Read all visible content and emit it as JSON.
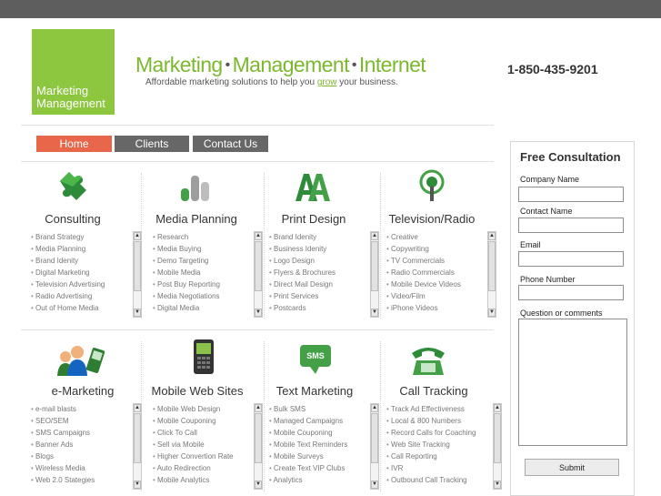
{
  "logo": {
    "line1": "Marketing",
    "line2": "Management"
  },
  "brand": {
    "word1": "Marketing",
    "word2": "Management",
    "word3": "Internet",
    "separator": "•"
  },
  "tagline": {
    "before": "Affordable marketing solutions to help you ",
    "link": "grow",
    "after": " your business."
  },
  "phone": "1-850-435-9201",
  "nav": {
    "home": "Home",
    "clients": "Clients",
    "contact": "Contact Us"
  },
  "services": [
    {
      "title": "Consulting",
      "items": [
        "Brand Strategy",
        "Media Planning",
        "Brand Idenity",
        "Digital Marketing",
        "Television Advertising",
        "Radio Advertising",
        "Out of Home Media"
      ]
    },
    {
      "title": "Media Planning",
      "items": [
        "Research",
        "Media Buying",
        "Demo Targeting",
        "Mobile Media",
        "Post Buy Reporting",
        "Media Negotiations",
        "Digital Media"
      ]
    },
    {
      "title": "Print Design",
      "items": [
        "Brand Idenity",
        "Business Idenity",
        "Logo Design",
        "Flyers & Brochures",
        "Direct Mail Design",
        "Print Services",
        "Postcards"
      ]
    },
    {
      "title": "Television/Radio",
      "items": [
        "Creative",
        "Copywriting",
        "TV Commercials",
        "Radio Commercials",
        "Mobile Device Videos",
        "Video/Film",
        "iPhone Videos"
      ]
    },
    {
      "title": "e-Marketing",
      "items": [
        "e-mail blasts",
        "SEO/SEM",
        "SMS Campaigns",
        "Banner Ads",
        "Blogs",
        "Wireless Media",
        "Web 2.0 Stategies"
      ]
    },
    {
      "title": "Mobile Web Sites",
      "items": [
        "Mobile Web Design",
        "Mobile Couponing",
        "Click To Call",
        "Sell via Mobile",
        "Higher Convertion Rate",
        "Auto Redirection",
        "Mobile Analytics"
      ]
    },
    {
      "title": "Text Marketing",
      "items": [
        "Bulk SMS",
        "Managed Campaigns",
        "Mobile Couponing",
        "Mobile Text Reminders",
        "Mobile Surveys",
        "Create Text VIP Clubs",
        "Analytics"
      ]
    },
    {
      "title": "Call Tracking",
      "items": [
        "Track Ad Effectiveness",
        "Local & 800 Numbers",
        "Record Calls for Coaching",
        "Web Site Tracking",
        "Call Reporting",
        "IVR",
        "Outbound Call Tracking"
      ]
    }
  ],
  "icons": {
    "sms_text": "SMS"
  },
  "consultation": {
    "title": "Free Consultation",
    "company_label": "Company Name",
    "contact_label": "Contact Name",
    "email_label": "Email",
    "phone_label": "Phone Number",
    "question_label": "Question or comments",
    "submit": "Submit"
  },
  "colors": {
    "brand_green": "#8dc63f",
    "nav_active": "#e8674a",
    "nav_inactive": "#676767"
  }
}
